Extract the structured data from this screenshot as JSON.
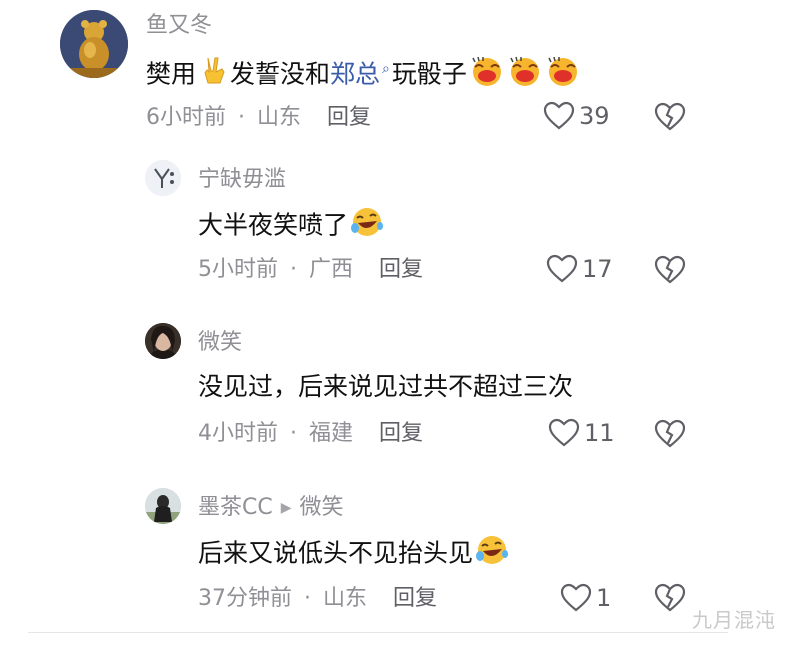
{
  "comments": [
    {
      "username": "鱼又冬",
      "content_pre": "樊用",
      "content_mid": "发誓没和",
      "mention": "郑总",
      "content_post": "玩骰子",
      "time": "6小时前",
      "location": "山东",
      "reply_label": "回复",
      "likes": "39",
      "avatar_icon": "gold-bear-avatar",
      "emojis": [
        "victory-hand-emoji",
        "drool-face-emoji",
        "drool-face-emoji",
        "drool-face-emoji"
      ]
    },
    {
      "username": "宁缺毋滥",
      "content": "大半夜笑喷了",
      "time": "5小时前",
      "location": "广西",
      "reply_label": "回复",
      "likes": "17",
      "avatar_icon": "letter-y-avatar",
      "emoji": "rofl-emoji"
    },
    {
      "username": "微笑",
      "content": "没见过，后来说见过共不超过三次",
      "time": "4小时前",
      "location": "福建",
      "reply_label": "回复",
      "likes": "11",
      "avatar_icon": "portrait-avatar"
    },
    {
      "username": "墨茶CC",
      "reply_to": "微笑",
      "content": "后来又说低头不见抬头见",
      "time": "37分钟前",
      "location": "山东",
      "reply_label": "回复",
      "likes": "1",
      "avatar_icon": "silhouette-avatar",
      "emoji": "rofl-emoji"
    }
  ],
  "separator": "·",
  "watermark": "九月混沌",
  "colors": {
    "meta_gray": "#8f8f95",
    "mention_blue": "#3a5ca9",
    "text_dark": "#111111"
  }
}
